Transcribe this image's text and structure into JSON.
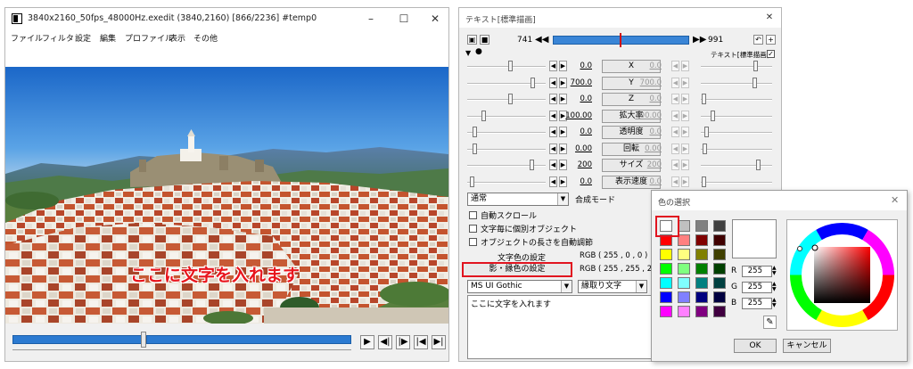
{
  "preview": {
    "title": "3840x2160_50fps_48000Hz.exedit (3840,2160)  [866/2236]  #temp0",
    "menu": [
      "ファイル",
      "フィルタ",
      "設定",
      "編集",
      "プロファイル",
      "表示",
      "その他"
    ],
    "caption": "ここに文字を入れます",
    "controls": [
      "▶",
      "◀|",
      "|▶",
      "|◀",
      "▶|"
    ]
  },
  "text_window": {
    "title": "テキスト[標準描画]",
    "frame_start": "741",
    "frame_end": "991",
    "object_label": "テキスト[標準描画]",
    "params": [
      {
        "label": "X",
        "left": "0.0",
        "right": "0.0"
      },
      {
        "label": "Y",
        "left": "700.0",
        "right": "700.0"
      },
      {
        "label": "Z",
        "left": "0.0",
        "right": "0.0"
      },
      {
        "label": "拡大率",
        "left": "100.00",
        "right": "100.00"
      },
      {
        "label": "透明度",
        "left": "0.0",
        "right": "0.0"
      },
      {
        "label": "回転",
        "left": "0.00",
        "right": "0.00"
      },
      {
        "label": "サイズ",
        "left": "200",
        "right": "200"
      },
      {
        "label": "表示速度",
        "left": "0.0",
        "right": "0.0"
      }
    ],
    "blend_mode": "通常",
    "blend_label": "合成モード",
    "checkboxes": [
      "自動スクロール",
      "文字毎に個別オブジェクト",
      "オブジェクトの長さを自動調節"
    ],
    "text_color_button": "文字色の設定",
    "text_color_value": "RGB ( 255 , 0 , 0 )",
    "shadow_color_button": "影・縁色の設定",
    "shadow_color_value": "RGB ( 255 , 255 , 255 )",
    "font": "MS UI Gothic",
    "style": "縁取り文字",
    "text_content": "ここに文字を入れます"
  },
  "color_dialog": {
    "title": "色の選択",
    "r_label": "R",
    "g_label": "G",
    "b_label": "B",
    "r": "255",
    "g": "255",
    "b": "255",
    "ok": "OK",
    "cancel": "キャンセル",
    "swatches": [
      "#ffffff",
      "#c0c0c0",
      "#808080",
      "#404040",
      "#ff0000",
      "#ff8080",
      "#800000",
      "#400000",
      "#ffff00",
      "#ffff80",
      "#808000",
      "#404000",
      "#00ff00",
      "#80ff80",
      "#008000",
      "#004000",
      "#00ffff",
      "#80ffff",
      "#008080",
      "#004040",
      "#0000ff",
      "#8080ff",
      "#000080",
      "#000040",
      "#ff00ff",
      "#ff80ff",
      "#800080",
      "#400040"
    ]
  },
  "colors": {
    "accent": "#2b7ad1",
    "highlight": "#e1141f",
    "caption": "#e8141c"
  }
}
